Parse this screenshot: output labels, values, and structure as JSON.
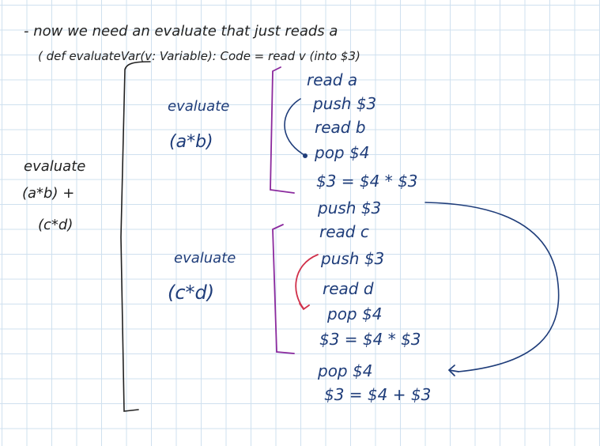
{
  "notes": {
    "intro_line": "- now we need an evaluate that just reads a",
    "def_line": "( def evaluateVar(v: Variable): Code = read v (into $3)",
    "whole_expr": {
      "label": "evaluate",
      "line1": "(a*b) +",
      "line2": "(c*d)"
    },
    "left_block": {
      "label": "evaluate",
      "expr": "(a*b)",
      "code": [
        "read a",
        "push $3",
        "read b",
        "pop $4",
        "$3 = $4 * $3"
      ]
    },
    "middle": {
      "code": [
        "push $3"
      ]
    },
    "right_block": {
      "label": "evaluate",
      "expr": "(c*d)",
      "code": [
        "read c",
        "push $3",
        "read d",
        "pop $4",
        "$3 = $4 * $3"
      ]
    },
    "final": {
      "code": [
        "pop $4",
        "$3 = $4 + $3"
      ]
    }
  },
  "colors": {
    "grid": "#cfe0ef",
    "black_ink": "#222222",
    "blue_ink": "#1f3d7a",
    "purple_ink": "#8b2a9e",
    "red_ink": "#d0304a"
  }
}
